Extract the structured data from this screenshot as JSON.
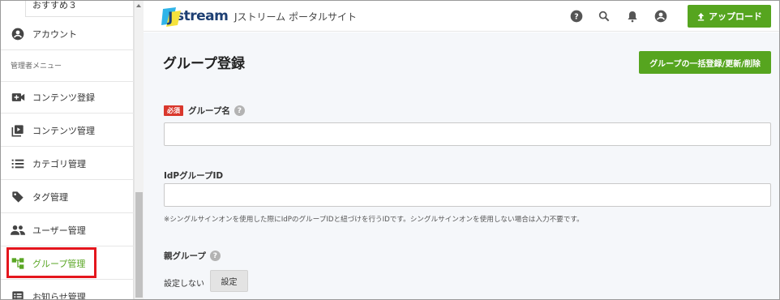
{
  "sidebar": {
    "sub_item": "おすすめ３",
    "account": "アカウント",
    "section_label": "管理者メニュー",
    "items": [
      {
        "label": "コンテンツ登録",
        "icon": "video-add-icon"
      },
      {
        "label": "コンテンツ管理",
        "icon": "video-library-icon"
      },
      {
        "label": "カテゴリ管理",
        "icon": "list-icon"
      },
      {
        "label": "タグ管理",
        "icon": "tag-icon"
      },
      {
        "label": "ユーザー管理",
        "icon": "people-icon"
      },
      {
        "label": "グループ管理",
        "icon": "group-tree-icon",
        "active": true
      },
      {
        "label": "お知らせ管理",
        "icon": "notice-icon"
      }
    ]
  },
  "header": {
    "logo_text": "stream",
    "logo_letter": "J",
    "portal_name": "Jストリーム ポータルサイト",
    "upload_label": "アップロード"
  },
  "main": {
    "title": "グループ登録",
    "bulk_button": "グループの一括登録/更新/削除",
    "required_badge": "必須",
    "group_name_label": "グループ名",
    "group_name_value": "",
    "idp_label": "IdPグループID",
    "idp_value": "",
    "idp_note": "※シングルサインオンを使用した際にIdPのグループIDと紐づけを行うIDです。シングルサインオンを使用しない場合は入力不要です。",
    "parent_label": "親グループ",
    "parent_value": "設定しない",
    "set_button": "設定"
  },
  "colors": {
    "accent_green": "#56a51f",
    "required_red": "#d9372c",
    "highlight_red": "#e4161d",
    "logo_navy": "#1d3f73"
  }
}
